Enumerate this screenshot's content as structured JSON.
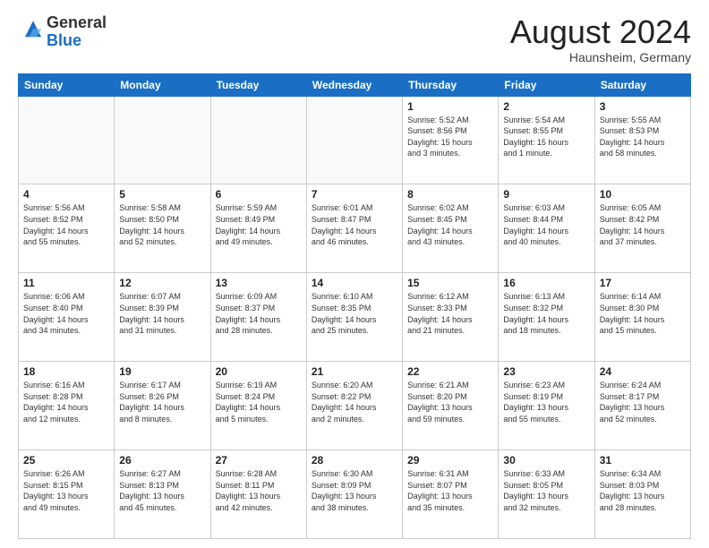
{
  "header": {
    "logo_general": "General",
    "logo_blue": "Blue",
    "month_year": "August 2024",
    "location": "Haunsheim, Germany"
  },
  "weekdays": [
    "Sunday",
    "Monday",
    "Tuesday",
    "Wednesday",
    "Thursday",
    "Friday",
    "Saturday"
  ],
  "weeks": [
    [
      {
        "day": "",
        "info": ""
      },
      {
        "day": "",
        "info": ""
      },
      {
        "day": "",
        "info": ""
      },
      {
        "day": "",
        "info": ""
      },
      {
        "day": "1",
        "info": "Sunrise: 5:52 AM\nSunset: 8:56 PM\nDaylight: 15 hours\nand 3 minutes."
      },
      {
        "day": "2",
        "info": "Sunrise: 5:54 AM\nSunset: 8:55 PM\nDaylight: 15 hours\nand 1 minute."
      },
      {
        "day": "3",
        "info": "Sunrise: 5:55 AM\nSunset: 8:53 PM\nDaylight: 14 hours\nand 58 minutes."
      }
    ],
    [
      {
        "day": "4",
        "info": "Sunrise: 5:56 AM\nSunset: 8:52 PM\nDaylight: 14 hours\nand 55 minutes."
      },
      {
        "day": "5",
        "info": "Sunrise: 5:58 AM\nSunset: 8:50 PM\nDaylight: 14 hours\nand 52 minutes."
      },
      {
        "day": "6",
        "info": "Sunrise: 5:59 AM\nSunset: 8:49 PM\nDaylight: 14 hours\nand 49 minutes."
      },
      {
        "day": "7",
        "info": "Sunrise: 6:01 AM\nSunset: 8:47 PM\nDaylight: 14 hours\nand 46 minutes."
      },
      {
        "day": "8",
        "info": "Sunrise: 6:02 AM\nSunset: 8:45 PM\nDaylight: 14 hours\nand 43 minutes."
      },
      {
        "day": "9",
        "info": "Sunrise: 6:03 AM\nSunset: 8:44 PM\nDaylight: 14 hours\nand 40 minutes."
      },
      {
        "day": "10",
        "info": "Sunrise: 6:05 AM\nSunset: 8:42 PM\nDaylight: 14 hours\nand 37 minutes."
      }
    ],
    [
      {
        "day": "11",
        "info": "Sunrise: 6:06 AM\nSunset: 8:40 PM\nDaylight: 14 hours\nand 34 minutes."
      },
      {
        "day": "12",
        "info": "Sunrise: 6:07 AM\nSunset: 8:39 PM\nDaylight: 14 hours\nand 31 minutes."
      },
      {
        "day": "13",
        "info": "Sunrise: 6:09 AM\nSunset: 8:37 PM\nDaylight: 14 hours\nand 28 minutes."
      },
      {
        "day": "14",
        "info": "Sunrise: 6:10 AM\nSunset: 8:35 PM\nDaylight: 14 hours\nand 25 minutes."
      },
      {
        "day": "15",
        "info": "Sunrise: 6:12 AM\nSunset: 8:33 PM\nDaylight: 14 hours\nand 21 minutes."
      },
      {
        "day": "16",
        "info": "Sunrise: 6:13 AM\nSunset: 8:32 PM\nDaylight: 14 hours\nand 18 minutes."
      },
      {
        "day": "17",
        "info": "Sunrise: 6:14 AM\nSunset: 8:30 PM\nDaylight: 14 hours\nand 15 minutes."
      }
    ],
    [
      {
        "day": "18",
        "info": "Sunrise: 6:16 AM\nSunset: 8:28 PM\nDaylight: 14 hours\nand 12 minutes."
      },
      {
        "day": "19",
        "info": "Sunrise: 6:17 AM\nSunset: 8:26 PM\nDaylight: 14 hours\nand 8 minutes."
      },
      {
        "day": "20",
        "info": "Sunrise: 6:19 AM\nSunset: 8:24 PM\nDaylight: 14 hours\nand 5 minutes."
      },
      {
        "day": "21",
        "info": "Sunrise: 6:20 AM\nSunset: 8:22 PM\nDaylight: 14 hours\nand 2 minutes."
      },
      {
        "day": "22",
        "info": "Sunrise: 6:21 AM\nSunset: 8:20 PM\nDaylight: 13 hours\nand 59 minutes."
      },
      {
        "day": "23",
        "info": "Sunrise: 6:23 AM\nSunset: 8:19 PM\nDaylight: 13 hours\nand 55 minutes."
      },
      {
        "day": "24",
        "info": "Sunrise: 6:24 AM\nSunset: 8:17 PM\nDaylight: 13 hours\nand 52 minutes."
      }
    ],
    [
      {
        "day": "25",
        "info": "Sunrise: 6:26 AM\nSunset: 8:15 PM\nDaylight: 13 hours\nand 49 minutes."
      },
      {
        "day": "26",
        "info": "Sunrise: 6:27 AM\nSunset: 8:13 PM\nDaylight: 13 hours\nand 45 minutes."
      },
      {
        "day": "27",
        "info": "Sunrise: 6:28 AM\nSunset: 8:11 PM\nDaylight: 13 hours\nand 42 minutes."
      },
      {
        "day": "28",
        "info": "Sunrise: 6:30 AM\nSunset: 8:09 PM\nDaylight: 13 hours\nand 38 minutes."
      },
      {
        "day": "29",
        "info": "Sunrise: 6:31 AM\nSunset: 8:07 PM\nDaylight: 13 hours\nand 35 minutes."
      },
      {
        "day": "30",
        "info": "Sunrise: 6:33 AM\nSunset: 8:05 PM\nDaylight: 13 hours\nand 32 minutes."
      },
      {
        "day": "31",
        "info": "Sunrise: 6:34 AM\nSunset: 8:03 PM\nDaylight: 13 hours\nand 28 minutes."
      }
    ]
  ]
}
